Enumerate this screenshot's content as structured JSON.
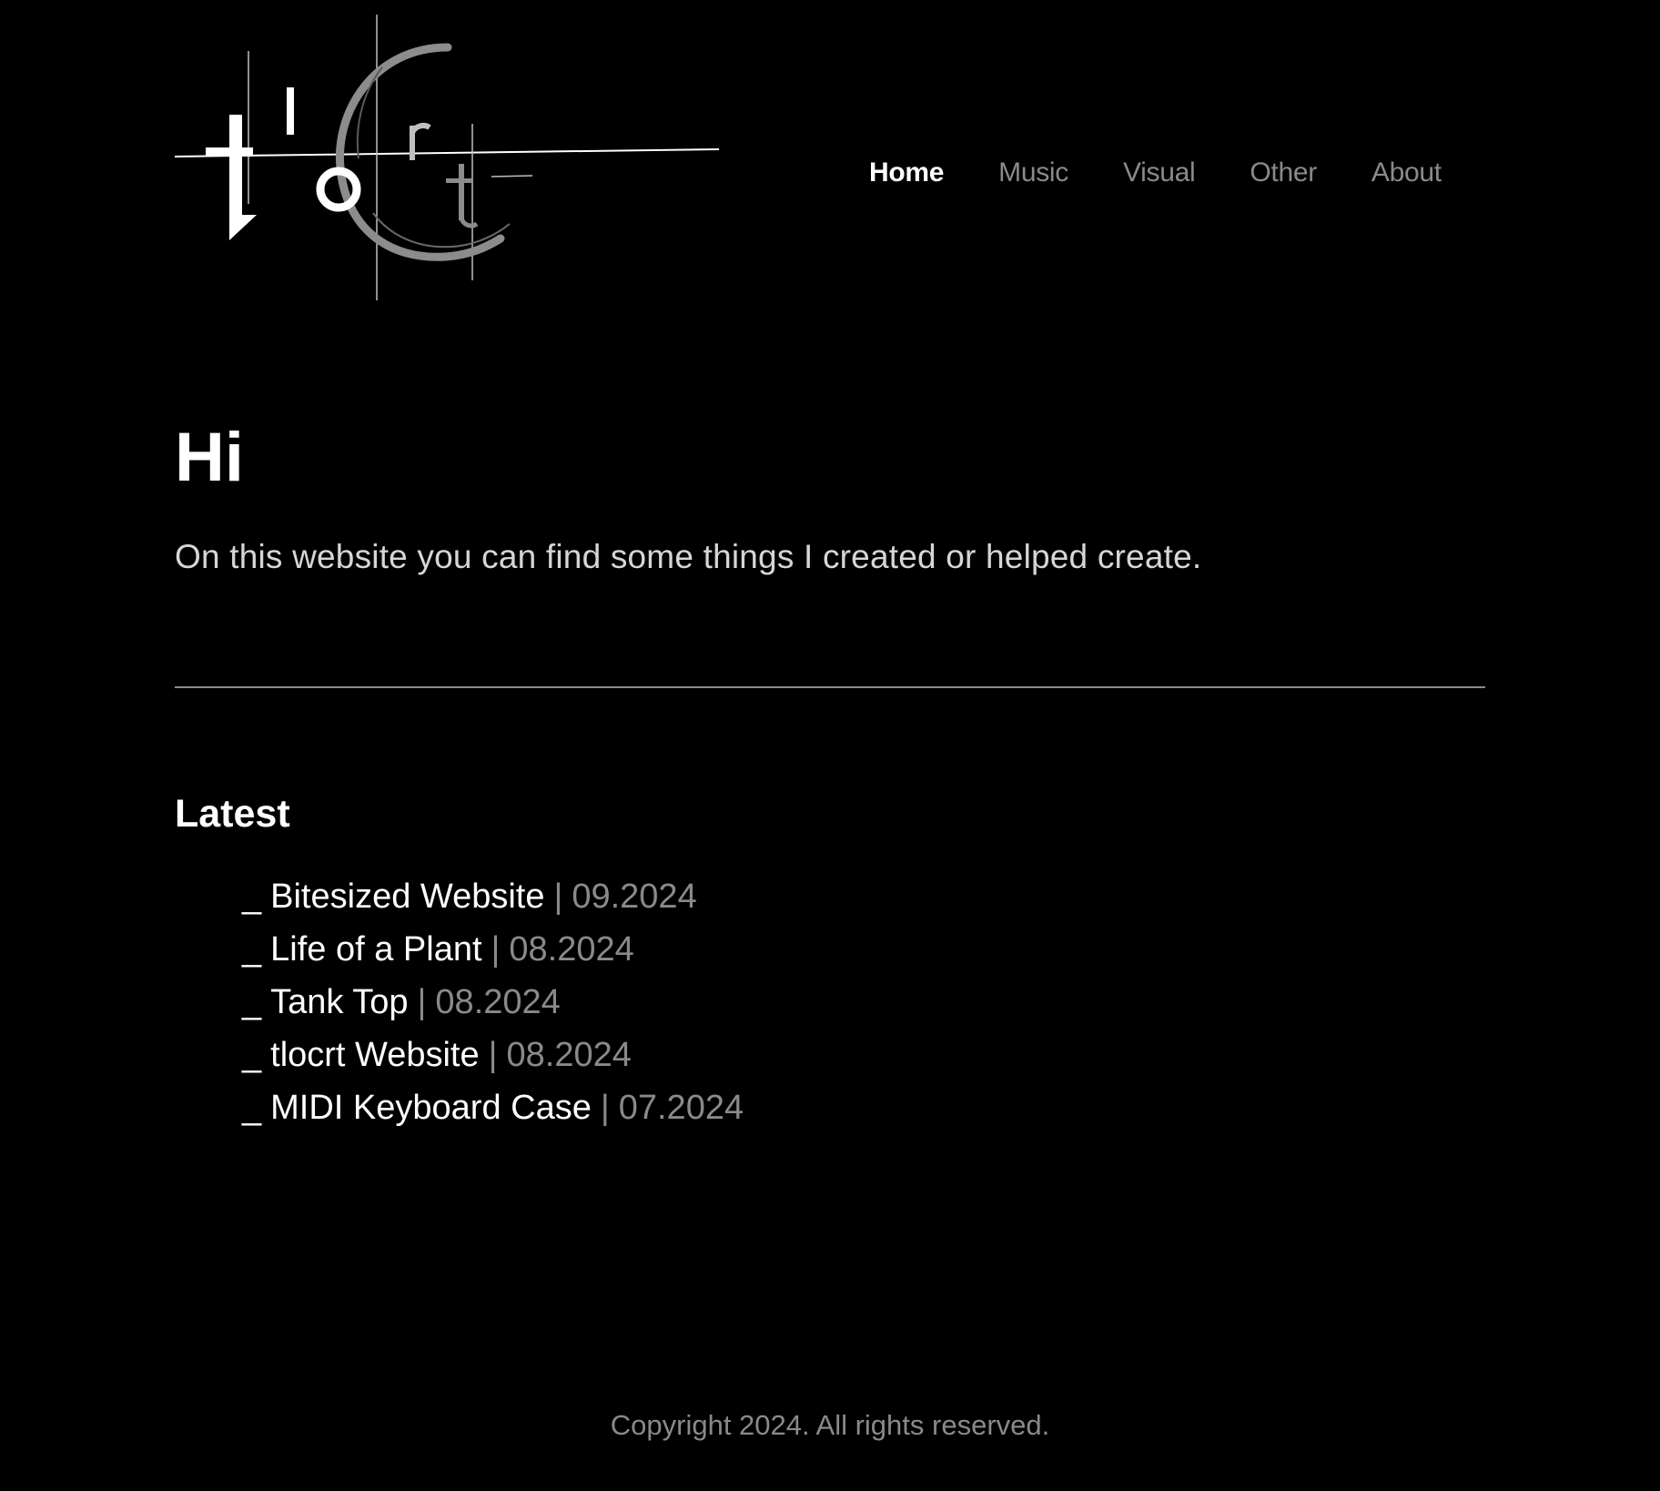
{
  "site": {
    "logo_text": "tlocrt",
    "logo_glyphs": [
      "t",
      "l",
      "o",
      "C",
      "r",
      "t"
    ]
  },
  "nav": {
    "items": [
      {
        "label": "Home",
        "active": true
      },
      {
        "label": "Music",
        "active": false
      },
      {
        "label": "Visual",
        "active": false
      },
      {
        "label": "Other",
        "active": false
      },
      {
        "label": "About",
        "active": false
      }
    ]
  },
  "hero": {
    "title": "Hi",
    "text": "On this website you can find some things I created or helped create."
  },
  "latest": {
    "title": "Latest",
    "bullet": "_",
    "separator": "|",
    "items": [
      {
        "title": "Bitesized Website",
        "date": "09.2024"
      },
      {
        "title": "Life of a Plant",
        "date": "08.2024"
      },
      {
        "title": "Tank Top",
        "date": "08.2024"
      },
      {
        "title": "tlocrt Website",
        "date": "08.2024"
      },
      {
        "title": "MIDI Keyboard Case",
        "date": "07.2024"
      }
    ]
  },
  "footer": {
    "text": "Copyright 2024. All rights reserved."
  },
  "colors": {
    "background": "#000000",
    "text": "#ffffff",
    "muted": "#8a8a8a",
    "body_text": "#d6d6d6",
    "divider": "#8c8c8c"
  }
}
